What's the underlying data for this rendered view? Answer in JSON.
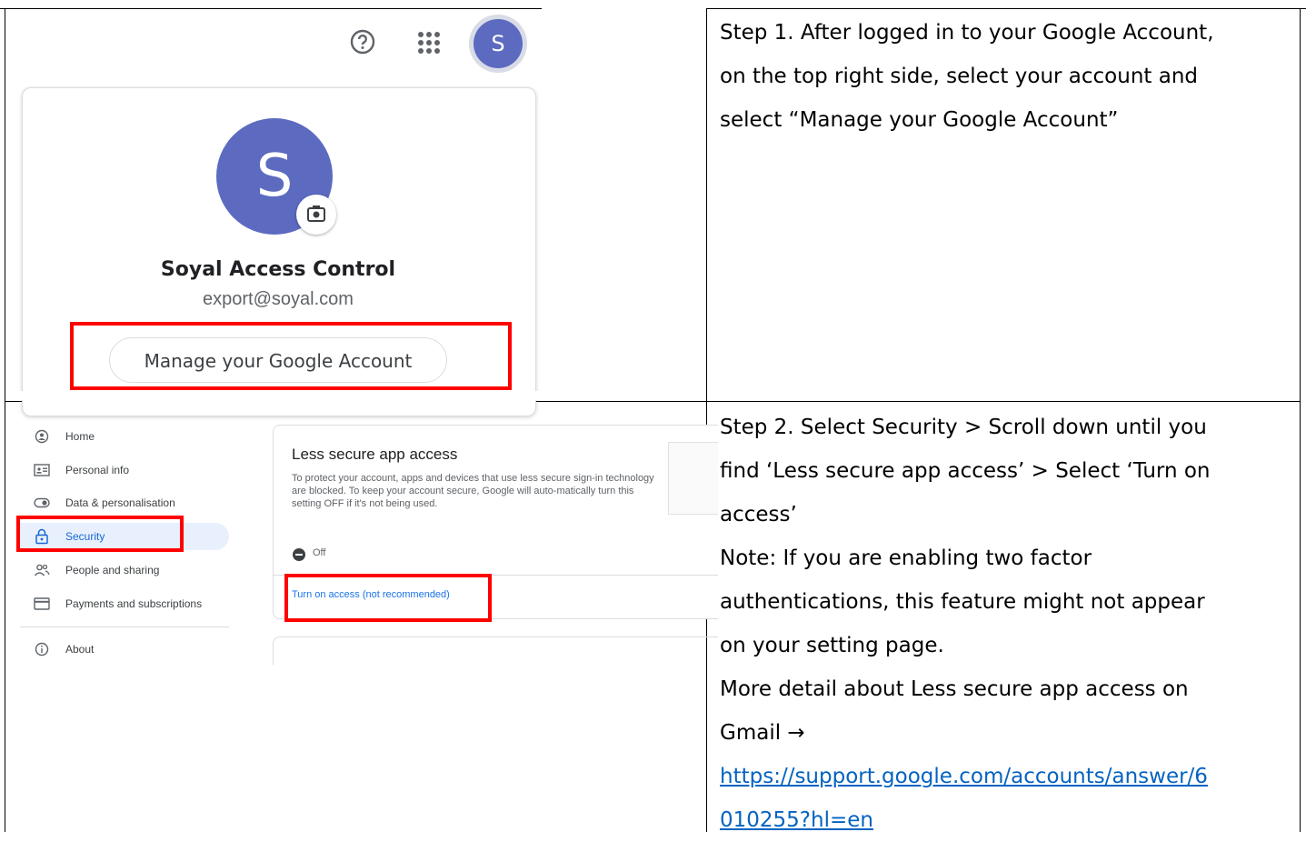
{
  "step1": {
    "text_lines": [
      "Step 1. After logged in to your Google Account,",
      "on the top right side, select your account and",
      "select “Manage your Google Account”"
    ]
  },
  "account_popup": {
    "avatar_letter_small": "S",
    "avatar_letter_large": "S",
    "name": "Soyal Access Control",
    "email": "export@soyal.com",
    "manage_button": "Manage your Google Account",
    "icons": [
      "help-icon",
      "apps-grid-icon",
      "camera-icon"
    ],
    "avatar_color": "#5c6bc0"
  },
  "security_page": {
    "nav": [
      {
        "label": "Home",
        "icon": "home-icon"
      },
      {
        "label": "Personal info",
        "icon": "id-card-icon"
      },
      {
        "label": "Data & personalisation",
        "icon": "toggle-icon"
      },
      {
        "label": "Security",
        "icon": "lock-icon",
        "active": true
      },
      {
        "label": "People and sharing",
        "icon": "people-icon"
      },
      {
        "label": "Payments and subscriptions",
        "icon": "credit-card-icon"
      },
      {
        "label": "About",
        "icon": "info-icon"
      }
    ],
    "card_title": "Less secure app access",
    "card_desc": "To protect your account, apps and devices that use less secure sign-in technology are blocked. To keep your account secure, Google will auto-matically turn this setting OFF if it's not being used.",
    "state": "Off",
    "turn_on_link": "Turn on access (not recommended)"
  },
  "step2": {
    "lines": [
      "Step 2. Select Security > Scroll down until you",
      "find ‘Less secure app access’ > Select ‘Turn on",
      "access’",
      "Note: If you are enabling two factor",
      "authentications, this feature might not appear",
      "on your setting page.",
      "More detail about Less secure app access on",
      "Gmail →"
    ],
    "link_lines": [
      "https://support.google.com/accounts/answer/6",
      "010255?hl=en"
    ]
  },
  "highlight_color": "#ff0000",
  "link_color": "#0563c1"
}
